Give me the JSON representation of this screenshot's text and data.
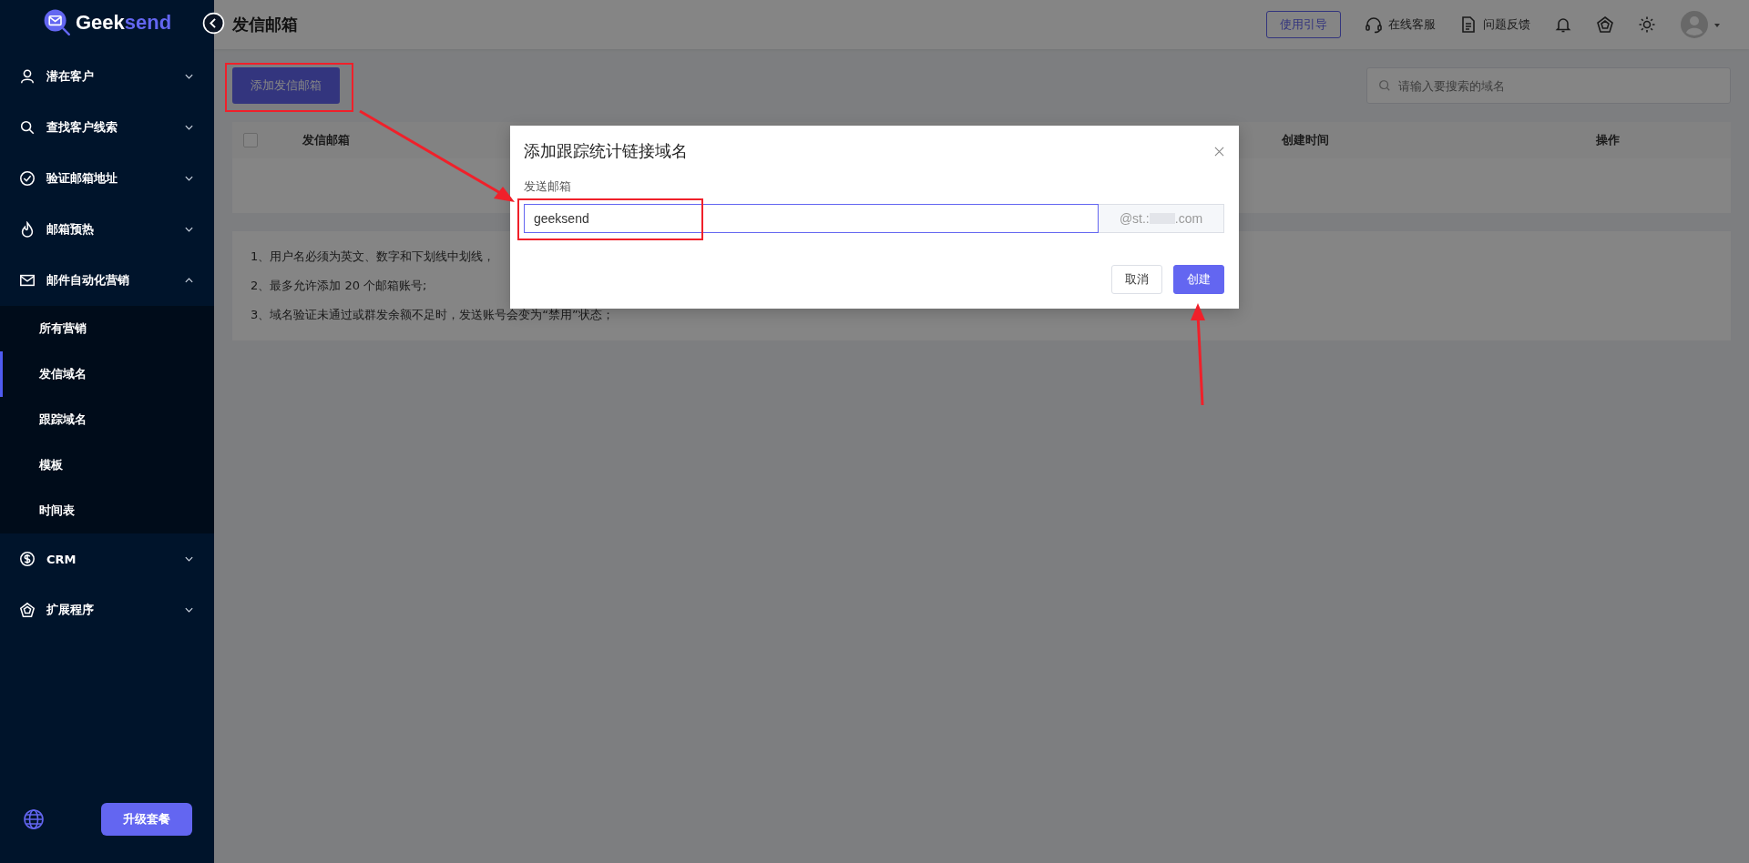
{
  "brand": {
    "name_start": "Geek",
    "name_end": "send"
  },
  "page_title": "发信邮箱",
  "header": {
    "guide_button": "使用引导",
    "links": [
      {
        "label": "在线客服",
        "kind": "headset"
      },
      {
        "label": "问题反馈",
        "kind": "doc"
      }
    ]
  },
  "sidebar": {
    "items": [
      {
        "label": "潜在客户",
        "kind": "user",
        "expanded": false
      },
      {
        "label": "查找客户线索",
        "kind": "search",
        "expanded": false
      },
      {
        "label": "验证邮箱地址",
        "kind": "check",
        "expanded": false
      },
      {
        "label": "邮箱预热",
        "kind": "flame",
        "expanded": false
      },
      {
        "label": "邮件自动化营销",
        "kind": "mail",
        "expanded": true,
        "children": [
          {
            "label": "所有营销",
            "selected": false
          },
          {
            "label": "发信域名",
            "selected": true
          },
          {
            "label": "跟踪域名",
            "selected": false
          },
          {
            "label": "模板",
            "selected": false
          },
          {
            "label": "时间表",
            "selected": false
          }
        ]
      },
      {
        "label": "CRM",
        "kind": "dollar",
        "expanded": false
      },
      {
        "label": "扩展程序",
        "kind": "gem",
        "expanded": false
      }
    ],
    "upgrade_button": "升级套餐"
  },
  "toolbar": {
    "add_button": "添加发信邮箱",
    "search": {
      "placeholder": "请输入要搜索的域名"
    }
  },
  "table": {
    "select_all": {
      "checked": false
    },
    "columns": [
      "发信邮箱",
      "创建时间",
      "操作"
    ]
  },
  "notes": [
    "1、用户名必须为英文、数字和下划线中划线，",
    "2、最多允许添加 20 个邮箱账号;",
    "3、域名验证未通过或群发余额不足时，发送账号会变为“禁用”状态；"
  ],
  "dialog": {
    "title": "添加跟踪统计链接域名",
    "field_label": "发送邮箱",
    "value": "geeksend",
    "suffix_start": "@st.:",
    "suffix_end": ".com",
    "buttons": [
      {
        "label": "取消",
        "kind": "default"
      },
      {
        "label": "创建",
        "kind": "primary"
      }
    ]
  }
}
